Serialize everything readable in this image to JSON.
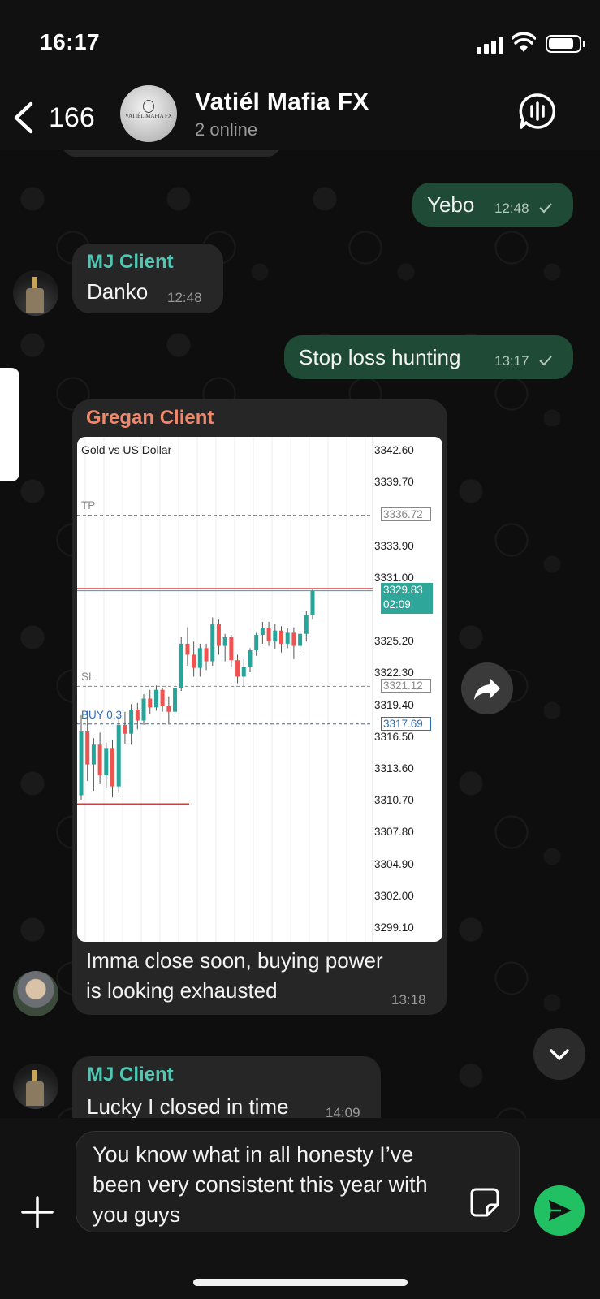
{
  "status_bar": {
    "time": "16:17"
  },
  "header": {
    "back_count": "166",
    "title": "Vatiél Mafia FX",
    "subtitle": "2 online",
    "avatar_logo_text": "VATIÉL MAFIA FX"
  },
  "messages": [
    {
      "direction": "outgoing",
      "text": "Yebo",
      "time": "12:48",
      "read": true
    },
    {
      "direction": "incoming",
      "sender": "MJ Client",
      "text": "Danko",
      "time": "12:48"
    },
    {
      "direction": "outgoing",
      "text": "Stop loss hunting",
      "time": "13:17",
      "read": true
    },
    {
      "direction": "incoming",
      "sender": "Gregan Client",
      "caption_line1": "Imma close soon, buying power",
      "caption_line2": "is looking exhausted",
      "time": "13:18"
    },
    {
      "direction": "incoming",
      "sender": "MJ Client",
      "text": "Lucky I closed in time",
      "time": "14:09"
    }
  ],
  "chart_data": {
    "type": "candlestick",
    "title": "Gold vs US Dollar",
    "y_ticks": [
      "3342.60",
      "3339.70",
      "3336.72",
      "3333.90",
      "3331.00",
      "3329.83",
      "3325.20",
      "3322.30",
      "3321.12",
      "3319.40",
      "3317.69",
      "3316.50",
      "3313.60",
      "3310.70",
      "3307.80",
      "3304.90",
      "3302.00",
      "3299.10"
    ],
    "ylim": [
      3299.1,
      3342.6
    ],
    "levels": [
      {
        "name": "TP",
        "value": 3336.72,
        "label": "3336.72",
        "color": "#888888"
      },
      {
        "name": "SL",
        "value": 3321.12,
        "label": "3321.12",
        "color": "#888888"
      },
      {
        "name": "BUY 0.3",
        "value": 3317.69,
        "label": "3317.69",
        "color": "#2d6fb5"
      }
    ],
    "current_price": {
      "value": 3329.83,
      "label": "3329.83",
      "countdown": "02:09",
      "color": "#2ea69a"
    },
    "candles": [
      [
        3311.2,
        3318.5,
        3310.8,
        3317.0
      ],
      [
        3317.0,
        3318.9,
        3312.5,
        3314.0
      ],
      [
        3314.0,
        3316.4,
        3311.6,
        3315.8
      ],
      [
        3315.8,
        3316.9,
        3312.2,
        3313.0
      ],
      [
        3313.0,
        3316.0,
        3311.9,
        3315.5
      ],
      [
        3315.5,
        3316.2,
        3311.0,
        3312.0
      ],
      [
        3312.0,
        3318.4,
        3311.4,
        3317.6
      ],
      [
        3317.6,
        3318.8,
        3315.9,
        3316.8
      ],
      [
        3316.8,
        3319.5,
        3315.8,
        3319.0
      ],
      [
        3319.0,
        3319.6,
        3317.2,
        3318.0
      ],
      [
        3318.0,
        3320.4,
        3317.6,
        3320.0
      ],
      [
        3320.0,
        3320.8,
        3318.6,
        3319.2
      ],
      [
        3319.2,
        3321.2,
        3318.9,
        3320.8
      ],
      [
        3320.8,
        3321.0,
        3318.8,
        3319.3
      ],
      [
        3319.3,
        3320.2,
        3317.8,
        3318.8
      ],
      [
        3318.8,
        3321.4,
        3318.5,
        3321.0
      ],
      [
        3321.0,
        3325.6,
        3320.7,
        3325.0
      ],
      [
        3325.0,
        3326.5,
        3323.0,
        3324.0
      ],
      [
        3324.0,
        3325.2,
        3322.0,
        3322.8
      ],
      [
        3322.8,
        3325.0,
        3322.0,
        3324.6
      ],
      [
        3324.6,
        3325.0,
        3322.6,
        3323.4
      ],
      [
        3323.4,
        3327.4,
        3323.0,
        3326.8
      ],
      [
        3326.8,
        3327.2,
        3324.0,
        3324.8
      ],
      [
        3324.8,
        3325.9,
        3323.4,
        3325.6
      ],
      [
        3325.6,
        3325.8,
        3322.9,
        3323.5
      ],
      [
        3323.5,
        3324.0,
        3321.4,
        3322.0
      ],
      [
        3322.0,
        3323.6,
        3321.1,
        3322.9
      ],
      [
        3322.9,
        3324.6,
        3322.4,
        3324.4
      ],
      [
        3324.4,
        3326.0,
        3323.9,
        3325.8
      ],
      [
        3325.8,
        3327.0,
        3325.0,
        3326.4
      ],
      [
        3326.4,
        3327.0,
        3324.8,
        3325.2
      ],
      [
        3325.2,
        3326.8,
        3324.5,
        3326.2
      ],
      [
        3326.2,
        3326.6,
        3324.2,
        3325.0
      ],
      [
        3325.0,
        3326.4,
        3324.6,
        3326.0
      ],
      [
        3326.0,
        3326.5,
        3323.6,
        3324.8
      ],
      [
        3324.8,
        3326.2,
        3324.4,
        3325.9
      ],
      [
        3325.9,
        3328.0,
        3325.2,
        3327.6
      ],
      [
        3327.6,
        3330.0,
        3327.2,
        3329.8
      ]
    ]
  },
  "input": {
    "draft_line1": "You know what in all honesty I’ve",
    "draft_line2": "been very consistent this year with",
    "draft_line3": "you guys"
  },
  "colors": {
    "outgoing_bubble": "#1e4a36",
    "incoming_bubble": "#262626",
    "mj_sender": "#4fc7b3",
    "gregan_sender": "#f0866a",
    "send_button": "#21c063"
  }
}
